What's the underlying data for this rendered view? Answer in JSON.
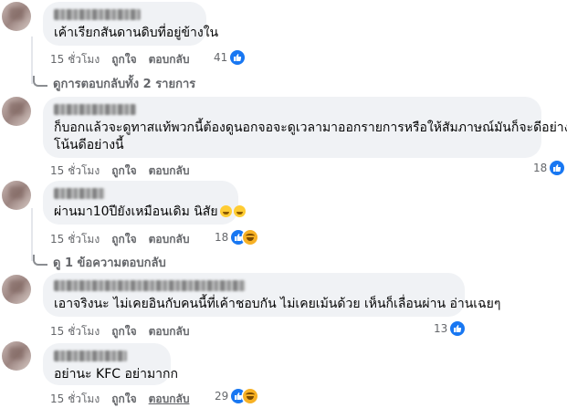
{
  "comments": [
    {
      "text": "เค้าเรียกสันดานดิบที่อยู่ข้างใน",
      "time": "15 ชั่วโมง",
      "like_label": "ถูกใจ",
      "reply_label": "ตอบกลับ",
      "reaction_count": "41",
      "reactions": [
        "like"
      ]
    },
    {
      "text_line1": "ก็บอกแล้วจะดูทาสแท้พวกนี้ต้องดูนอกจอจะดูเวลามาออกรายการหรือให้สัมภาษณ์มันก็จะดีอย่าง",
      "text_line2": "โน้นดีอย่างนี้",
      "time": "15 ชั่วโมง",
      "like_label": "ถูกใจ",
      "reply_label": "ตอบกลับ",
      "reaction_count": "18",
      "reactions": [
        "like"
      ]
    },
    {
      "text": "ผ่านมา10ปียังเหมือนเดิม นิสัย",
      "time": "15 ชั่วโมง",
      "like_label": "ถูกใจ",
      "reply_label": "ตอบกลับ",
      "reaction_count": "18",
      "reactions": [
        "like",
        "haha"
      ]
    },
    {
      "text": "เอาจริงนะ ไม่เคยอินกับคนนี้ที่เค้าชอบกัน ไม่เคยเม้นด้วย เห็นก็เลื่อนผ่าน อ่านเฉยๆ",
      "time": "15 ชั่วโมง",
      "like_label": "ถูกใจ",
      "reply_label": "ตอบกลับ",
      "reaction_count": "13",
      "reactions": [
        "like"
      ]
    },
    {
      "text": "อย่านะ KFC อย่ามากก",
      "time": "15 ชั่วโมง",
      "like_label": "ถูกใจ",
      "reply_label": "ตอบกลับ",
      "reaction_count": "29",
      "reactions": [
        "like",
        "haha"
      ]
    }
  ],
  "view_replies_1": "ดูการตอบกลับทั้ง 2 รายการ",
  "view_replies_3": "ดู 1 ข้อความตอบกลับ",
  "colors": {
    "bubble": "#f0f2f5",
    "like_blue": "#1877f2",
    "meta_gray": "#65676b"
  }
}
